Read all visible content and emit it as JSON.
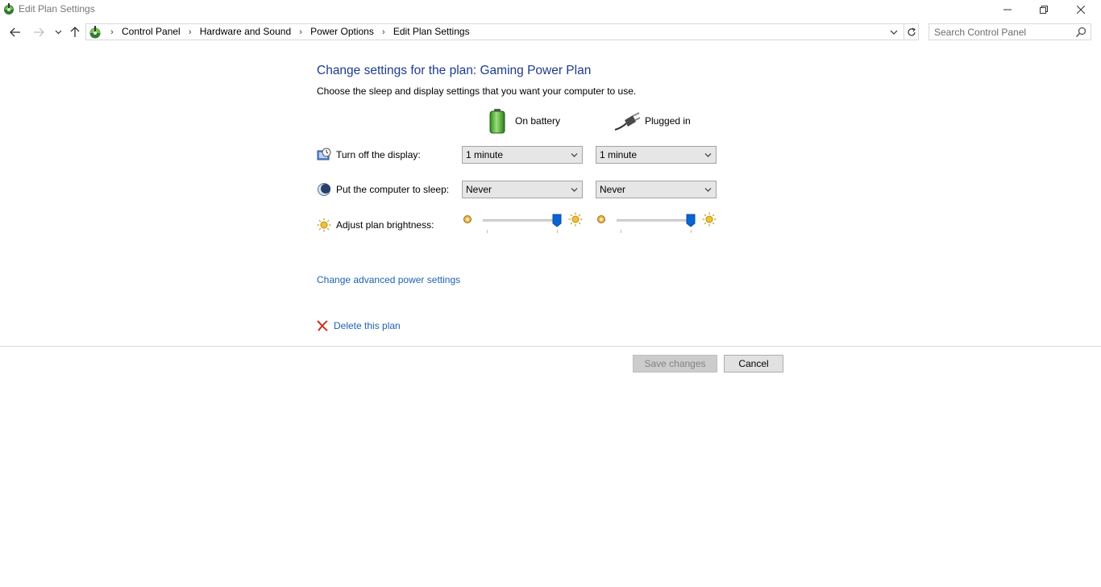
{
  "window": {
    "title": "Edit Plan Settings"
  },
  "nav": {
    "breadcrumbs": [
      "Control Panel",
      "Hardware and Sound",
      "Power Options",
      "Edit Plan Settings"
    ],
    "search_placeholder": "Search Control Panel"
  },
  "main": {
    "heading": "Change settings for the plan: Gaming Power Plan",
    "subheading": "Choose the sleep and display settings that you want your computer to use.",
    "columns": {
      "on_battery": "On battery",
      "plugged_in": "Plugged in"
    },
    "rows": {
      "display": {
        "label": "Turn off the display:",
        "on_battery": "1 minute",
        "plugged_in": "1 minute"
      },
      "sleep": {
        "label": "Put the computer to sleep:",
        "on_battery": "Never",
        "plugged_in": "Never"
      },
      "brightness": {
        "label": "Adjust plan brightness:",
        "on_battery_level": 1.0,
        "plugged_in_level": 1.0
      }
    },
    "advanced_link": "Change advanced power settings",
    "delete_link": "Delete this plan"
  },
  "buttons": {
    "save": "Save changes",
    "cancel": "Cancel"
  },
  "colors": {
    "heading": "#1e3c8c",
    "link": "#1e62b4",
    "slider_thumb": "#0a64d2"
  }
}
